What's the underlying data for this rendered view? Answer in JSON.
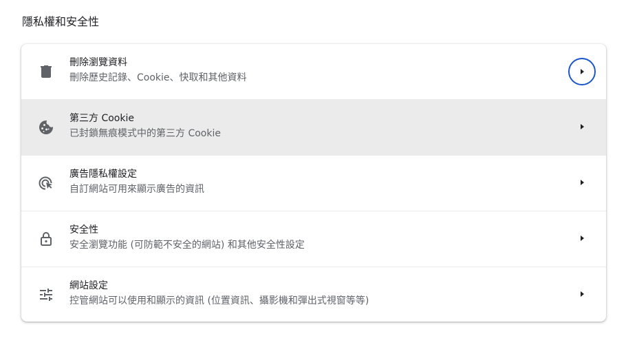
{
  "section": {
    "title": "隱私權和安全性"
  },
  "rows": [
    {
      "title": "刪除瀏覽資料",
      "subtitle": "刪除歷史記錄、Cookie、快取和其他資料",
      "icon": "trash-icon"
    },
    {
      "title": "第三方 Cookie",
      "subtitle": "已封鎖無痕模式中的第三方 Cookie",
      "icon": "cookie-icon"
    },
    {
      "title": "廣告隱私權設定",
      "subtitle": "自訂網站可用來顯示廣告的資訊",
      "icon": "ad-privacy-icon"
    },
    {
      "title": "安全性",
      "subtitle": "安全瀏覽功能 (可防範不安全的網站) 和其他安全性設定",
      "icon": "lock-icon"
    },
    {
      "title": "網站設定",
      "subtitle": "控管網站可以使用和顯示的資訊 (位置資訊、攝影機和彈出式視窗等等)",
      "icon": "tune-icon"
    }
  ],
  "colors": {
    "icon": "#5f6368",
    "focus_ring": "#1a56c9",
    "hover_bg": "#ebebeb"
  }
}
